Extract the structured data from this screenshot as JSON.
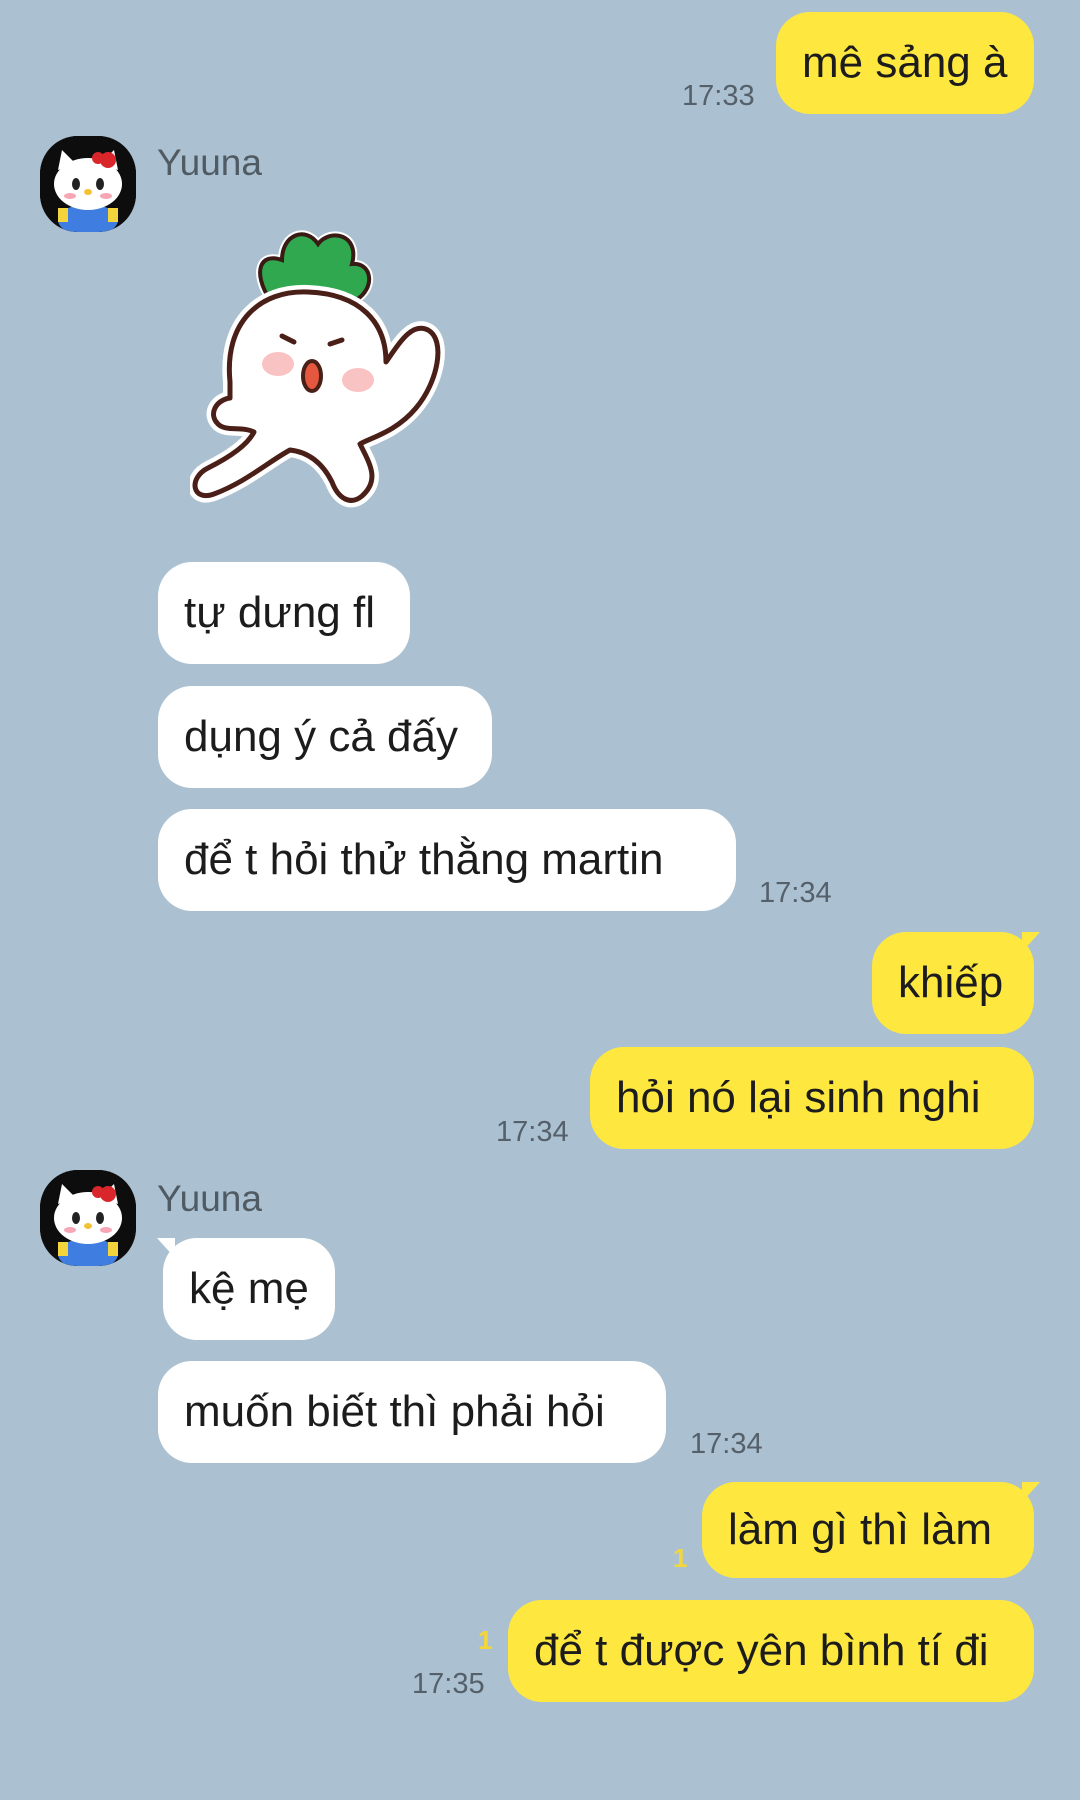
{
  "chat": {
    "messages": [
      {
        "text": "mê sảng à",
        "time": "17:33"
      },
      {
        "sender": "Yuuna",
        "sticker_icon": "radish-sticker-icon"
      },
      {
        "text": "tự dưng fl"
      },
      {
        "text": "dụng ý cả đấy"
      },
      {
        "text": "để t hỏi thử thằng martin",
        "time": "17:34"
      },
      {
        "text": "khiếp"
      },
      {
        "text": "hỏi nó lại sinh nghi",
        "time": "17:34"
      },
      {
        "sender": "Yuuna",
        "text": "kệ mẹ"
      },
      {
        "text": "muốn biết thì phải hỏi",
        "time": "17:34"
      },
      {
        "text": "làm gì thì làm",
        "unread": "1"
      },
      {
        "text": "để t được yên bình tí đi",
        "unread": "1",
        "time": "17:35"
      }
    ]
  },
  "colors": {
    "background": "#abc1d1",
    "outgoing_bubble": "#fee83f",
    "incoming_bubble": "#ffffff",
    "avatar_bg": "#0d0d0d",
    "unread_count": "#f5d63a"
  }
}
